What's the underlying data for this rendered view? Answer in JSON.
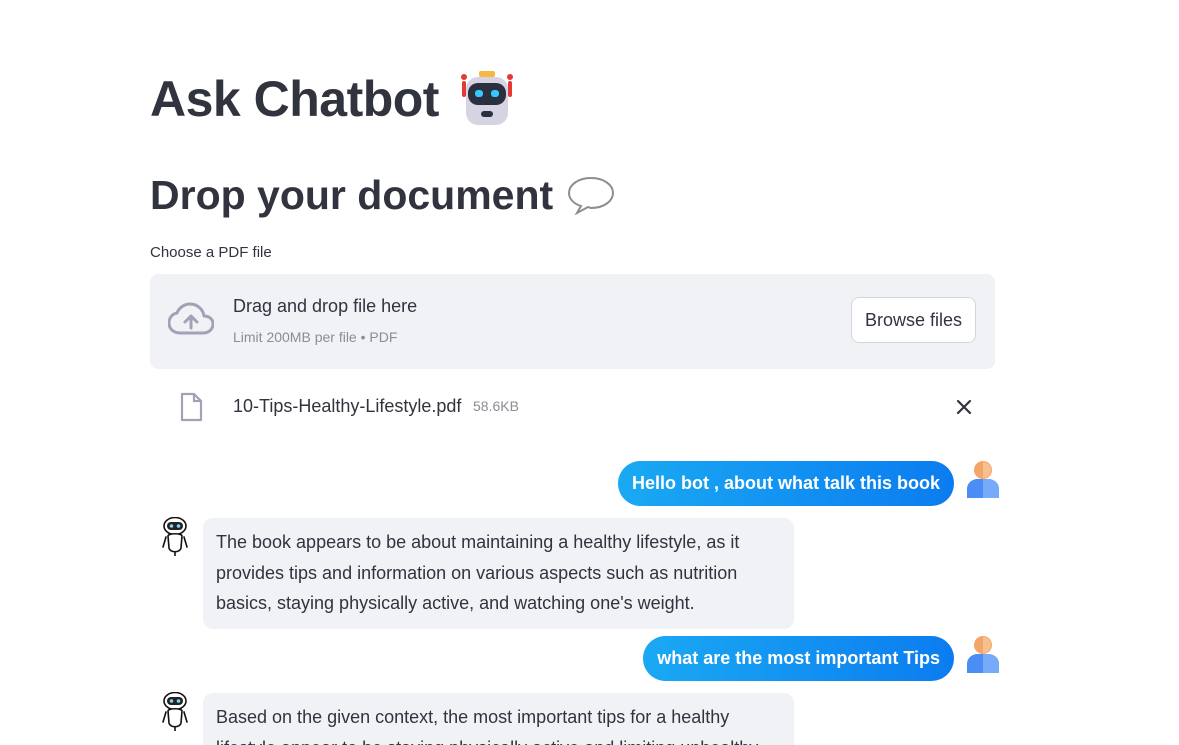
{
  "header": {
    "title": "Ask Chatbot",
    "title_icon": "robot-emoji",
    "subtitle": "Drop your document",
    "subtitle_icon": "speech-balloon-icon"
  },
  "uploader": {
    "label": "Choose a PDF file",
    "drop_text": "Drag and drop file here",
    "limit_text": "Limit 200MB per file • PDF",
    "browse_label": "Browse files",
    "file": {
      "name": "10-Tips-Healthy-Lifestyle.pdf",
      "size": "58.6KB"
    }
  },
  "chat": {
    "messages": [
      {
        "role": "user",
        "text": "Hello bot , about what talk this book"
      },
      {
        "role": "bot",
        "text": "The book appears to be about maintaining a healthy lifestyle, as it provides tips and information on various aspects such as nutrition basics, staying physically active, and watching one's weight."
      },
      {
        "role": "user",
        "text": "what are the most important Tips"
      },
      {
        "role": "bot",
        "text": "Based on the given context, the most important tips for a healthy lifestyle appear to be staying physically active and limiting unhealthy"
      }
    ]
  },
  "colors": {
    "accent_gradient_start": "#1aa9f3",
    "accent_gradient_end": "#0b7cf0",
    "panel_bg": "#f0f2f6",
    "text": "#31333f",
    "muted": "#8b8d96"
  }
}
